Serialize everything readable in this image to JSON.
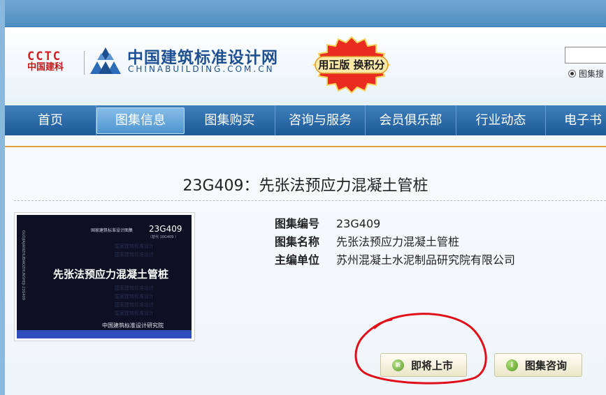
{
  "brand": {
    "cctc_text": "CCTC",
    "cctc_sub": "中国建科",
    "site_name_cn": "中国建筑标准设计网",
    "site_name_en": "CHINABUILDING.COM.CN",
    "promo_badge": "用正版 换积分"
  },
  "search": {
    "value": "",
    "radio_label": "图集搜"
  },
  "nav": {
    "items": [
      {
        "label": "首页"
      },
      {
        "label": "图集信息"
      },
      {
        "label": "图集购买"
      },
      {
        "label": "咨询与服务"
      },
      {
        "label": "会员俱乐部"
      },
      {
        "label": "行业动态"
      },
      {
        "label": "电子书"
      }
    ],
    "active_index": 1
  },
  "product": {
    "title": "23G409：先张法预应力混凝土管桩",
    "cover": {
      "series": "国家建筑标准设计图集",
      "code": "23G409",
      "sub": "（替代 10G409 ）",
      "side_text": "GUOJIAJIANZHUBIAOZHUNSHEJI 23G409",
      "title": "先张法预应力混凝土管桩",
      "watermark": "国家建筑标准设计",
      "publisher": "中国建筑标准设计研究院"
    },
    "fields": [
      {
        "label": "图集编号",
        "value": "23G409"
      },
      {
        "label": "图集名称",
        "value": "先张法预应力混凝土管桩"
      },
      {
        "label": "主编单位",
        "value": "苏州混凝土水泥制品研究院有限公司"
      }
    ]
  },
  "actions": {
    "coming_soon": {
      "label": "即将上市",
      "icon_text": "新"
    },
    "consult": {
      "label": "图集咨询",
      "icon_text": "i"
    }
  },
  "colors": {
    "nav_blue": "#1c5a96",
    "brand_blue": "#1d4f91",
    "cctc_red": "#d31f1f",
    "accent_orange": "#e5a13c",
    "annotation_red": "#e0101a"
  }
}
